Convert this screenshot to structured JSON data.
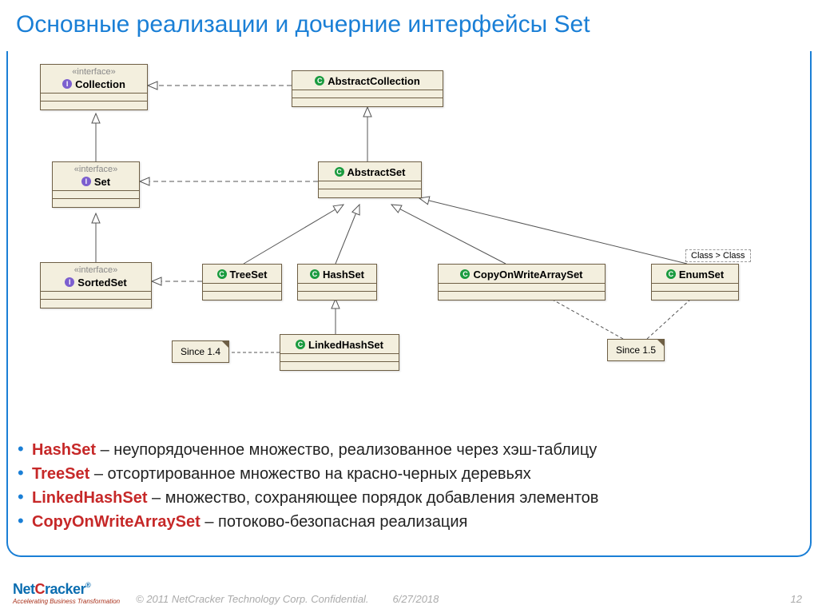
{
  "title": "Основные реализации и дочерние интерфейсы Set",
  "uml": {
    "stereotype_interface": "«interface»",
    "collection": "Collection",
    "set": "Set",
    "sortedset": "SortedSet",
    "abstractcollection": "AbstractCollection",
    "abstractset": "AbstractSet",
    "treeset": "TreeSet",
    "hashset": "HashSet",
    "linkedhashset": "LinkedHashSet",
    "cowarrayset": "CopyOnWriteArraySet",
    "enumset": "EnumSet",
    "param_tag": "Class > Class",
    "note_since14": "Since 1.4",
    "note_since15": "Since 1.5"
  },
  "bullets": [
    {
      "term": "HashSet",
      "desc": " – неупорядоченное множество, реализованное через хэш-таблицу"
    },
    {
      "term": "TreeSet",
      "desc": " – отсортированное множество на красно-черных деревьях"
    },
    {
      "term": "LinkedHashSet",
      "desc": " – множество, сохраняющее порядок добавления элементов"
    },
    {
      "term": "CopyOnWriteArraySet",
      "desc": " – потоково-безопасная реализация"
    }
  ],
  "footer": {
    "logo_text": "NetCracker",
    "logo_tag": "Accelerating Business Transformation",
    "copyright": "© 2011 NetCracker Technology Corp. Confidential.",
    "date": "6/27/2018",
    "page": "12"
  }
}
